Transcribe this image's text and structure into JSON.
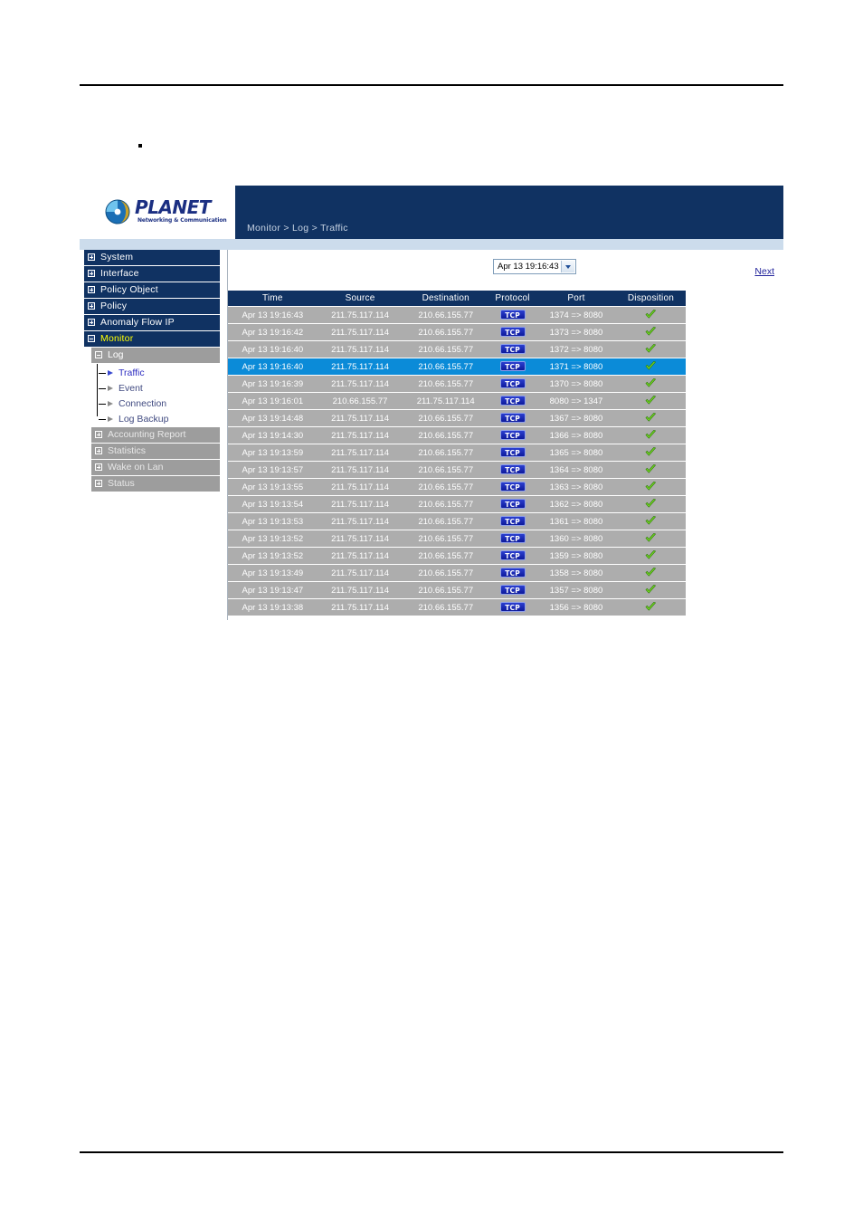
{
  "app": {
    "logo": {
      "name": "PLANET",
      "tagline": "Networking & Communication",
      "icon": "globe-icon"
    },
    "breadcrumb": "Monitor > Log > Traffic"
  },
  "sidebar": {
    "top_items": [
      {
        "label": "System",
        "icon": "expand-plus-icon",
        "active": false
      },
      {
        "label": "Interface",
        "icon": "expand-plus-icon",
        "active": false
      },
      {
        "label": "Policy Object",
        "icon": "expand-plus-icon",
        "active": false
      },
      {
        "label": "Policy",
        "icon": "expand-plus-icon",
        "active": false
      },
      {
        "label": "Anomaly Flow IP",
        "icon": "expand-plus-icon",
        "active": false
      },
      {
        "label": "Monitor",
        "icon": "collapse-minus-icon",
        "active": true
      }
    ],
    "log_group": {
      "label": "Log",
      "icon": "collapse-minus-icon"
    },
    "log_items": [
      {
        "label": "Traffic",
        "icon": "arrow-right-icon",
        "active": true
      },
      {
        "label": "Event",
        "icon": "arrow-right-icon",
        "active": false
      },
      {
        "label": "Connection",
        "icon": "arrow-right-icon",
        "active": false
      },
      {
        "label": "Log Backup",
        "icon": "arrow-right-icon",
        "active": false
      }
    ],
    "gray_items": [
      {
        "label": "Accounting Report",
        "icon": "expand-plus-icon"
      },
      {
        "label": "Statistics",
        "icon": "expand-plus-icon"
      },
      {
        "label": "Wake on Lan",
        "icon": "expand-plus-icon"
      },
      {
        "label": "Status",
        "icon": "expand-plus-icon"
      }
    ]
  },
  "toolbar": {
    "time_select_value": "Apr 13 19:16:43",
    "time_select_icon": "chevron-down-icon",
    "next_label": "Next"
  },
  "table": {
    "columns": [
      "Time",
      "Source",
      "Destination",
      "Protocol",
      "Port",
      "Disposition"
    ],
    "rows": [
      {
        "time": "Apr 13 19:16:43",
        "source": "211.75.117.114",
        "destination": "210.66.155.77",
        "protocol": "TCP",
        "port": "1374 => 8080",
        "disposition": "check-icon",
        "selected": false
      },
      {
        "time": "Apr 13 19:16:42",
        "source": "211.75.117.114",
        "destination": "210.66.155.77",
        "protocol": "TCP",
        "port": "1373 => 8080",
        "disposition": "check-icon",
        "selected": false
      },
      {
        "time": "Apr 13 19:16:40",
        "source": "211.75.117.114",
        "destination": "210.66.155.77",
        "protocol": "TCP",
        "port": "1372 => 8080",
        "disposition": "check-icon",
        "selected": false
      },
      {
        "time": "Apr 13 19:16:40",
        "source": "211.75.117.114",
        "destination": "210.66.155.77",
        "protocol": "TCP",
        "port": "1371 => 8080",
        "disposition": "check-icon",
        "selected": true
      },
      {
        "time": "Apr 13 19:16:39",
        "source": "211.75.117.114",
        "destination": "210.66.155.77",
        "protocol": "TCP",
        "port": "1370 => 8080",
        "disposition": "check-icon",
        "selected": false
      },
      {
        "time": "Apr 13 19:16:01",
        "source": "210.66.155.77",
        "destination": "211.75.117.114",
        "protocol": "TCP",
        "port": "8080 => 1347",
        "disposition": "check-icon",
        "selected": false
      },
      {
        "time": "Apr 13 19:14:48",
        "source": "211.75.117.114",
        "destination": "210.66.155.77",
        "protocol": "TCP",
        "port": "1367 => 8080",
        "disposition": "check-icon",
        "selected": false
      },
      {
        "time": "Apr 13 19:14:30",
        "source": "211.75.117.114",
        "destination": "210.66.155.77",
        "protocol": "TCP",
        "port": "1366 => 8080",
        "disposition": "check-icon",
        "selected": false
      },
      {
        "time": "Apr 13 19:13:59",
        "source": "211.75.117.114",
        "destination": "210.66.155.77",
        "protocol": "TCP",
        "port": "1365 => 8080",
        "disposition": "check-icon",
        "selected": false
      },
      {
        "time": "Apr 13 19:13:57",
        "source": "211.75.117.114",
        "destination": "210.66.155.77",
        "protocol": "TCP",
        "port": "1364 => 8080",
        "disposition": "check-icon",
        "selected": false
      },
      {
        "time": "Apr 13 19:13:55",
        "source": "211.75.117.114",
        "destination": "210.66.155.77",
        "protocol": "TCP",
        "port": "1363 => 8080",
        "disposition": "check-icon",
        "selected": false
      },
      {
        "time": "Apr 13 19:13:54",
        "source": "211.75.117.114",
        "destination": "210.66.155.77",
        "protocol": "TCP",
        "port": "1362 => 8080",
        "disposition": "check-icon",
        "selected": false
      },
      {
        "time": "Apr 13 19:13:53",
        "source": "211.75.117.114",
        "destination": "210.66.155.77",
        "protocol": "TCP",
        "port": "1361 => 8080",
        "disposition": "check-icon",
        "selected": false
      },
      {
        "time": "Apr 13 19:13:52",
        "source": "211.75.117.114",
        "destination": "210.66.155.77",
        "protocol": "TCP",
        "port": "1360 => 8080",
        "disposition": "check-icon",
        "selected": false
      },
      {
        "time": "Apr 13 19:13:52",
        "source": "211.75.117.114",
        "destination": "210.66.155.77",
        "protocol": "TCP",
        "port": "1359 => 8080",
        "disposition": "check-icon",
        "selected": false
      },
      {
        "time": "Apr 13 19:13:49",
        "source": "211.75.117.114",
        "destination": "210.66.155.77",
        "protocol": "TCP",
        "port": "1358 => 8080",
        "disposition": "check-icon",
        "selected": false
      },
      {
        "time": "Apr 13 19:13:47",
        "source": "211.75.117.114",
        "destination": "210.66.155.77",
        "protocol": "TCP",
        "port": "1357 => 8080",
        "disposition": "check-icon",
        "selected": false
      },
      {
        "time": "Apr 13 19:13:38",
        "source": "211.75.117.114",
        "destination": "210.66.155.77",
        "protocol": "TCP",
        "port": "1356 => 8080",
        "disposition": "check-icon",
        "selected": false
      }
    ]
  },
  "colors": {
    "header_navy": "#103262",
    "strip_blue": "#ccdcec",
    "row_gray": "#adadad",
    "row_selected": "#0b8bd8",
    "accent_yellow": "#ffff00",
    "link_blue": "#23249c",
    "check_green": "#7ce026"
  }
}
